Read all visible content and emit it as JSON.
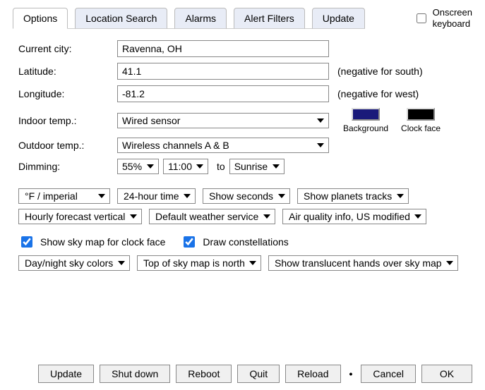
{
  "tabs": [
    "Options",
    "Location Search",
    "Alarms",
    "Alert Filters",
    "Update"
  ],
  "active_tab": "Options",
  "onscreen_keyboard": {
    "label": "Onscreen\nkeyboard",
    "checked": false
  },
  "fields": {
    "current_city": {
      "label": "Current city:",
      "value": "Ravenna, OH"
    },
    "latitude": {
      "label": "Latitude:",
      "value": "41.1",
      "hint": "(negative for south)"
    },
    "longitude": {
      "label": "Longitude:",
      "value": "-81.2",
      "hint": "(negative for west)"
    },
    "indoor_temp": {
      "label": "Indoor temp.:",
      "value": "Wired sensor"
    },
    "outdoor_temp": {
      "label": "Outdoor temp.:",
      "value": "Wireless channels A & B"
    },
    "dimming": {
      "label": "Dimming:",
      "percent": "55%",
      "start": "11:00",
      "to": "to",
      "end": "Sunrise"
    }
  },
  "swatches": {
    "background": {
      "label": "Background",
      "color": "#1a1a7a"
    },
    "clock_face": {
      "label": "Clock face",
      "color": "#000000"
    }
  },
  "display_options_row1": [
    "°F / imperial",
    "24-hour time",
    "Show seconds",
    "Show planets tracks"
  ],
  "display_options_row2": [
    "Hourly forecast vertical",
    "Default weather service",
    "Air quality info, US modified"
  ],
  "sky": {
    "show_sky_map": {
      "label": "Show sky map for clock face",
      "checked": true
    },
    "draw_constellations": {
      "label": "Draw constellations",
      "checked": true
    },
    "options": [
      "Day/night sky colors",
      "Top of sky map is north",
      "Show translucent hands over sky map"
    ]
  },
  "footer": {
    "update": "Update",
    "shut_down": "Shut down",
    "reboot": "Reboot",
    "quit": "Quit",
    "reload": "Reload",
    "cancel": "Cancel",
    "ok": "OK"
  }
}
